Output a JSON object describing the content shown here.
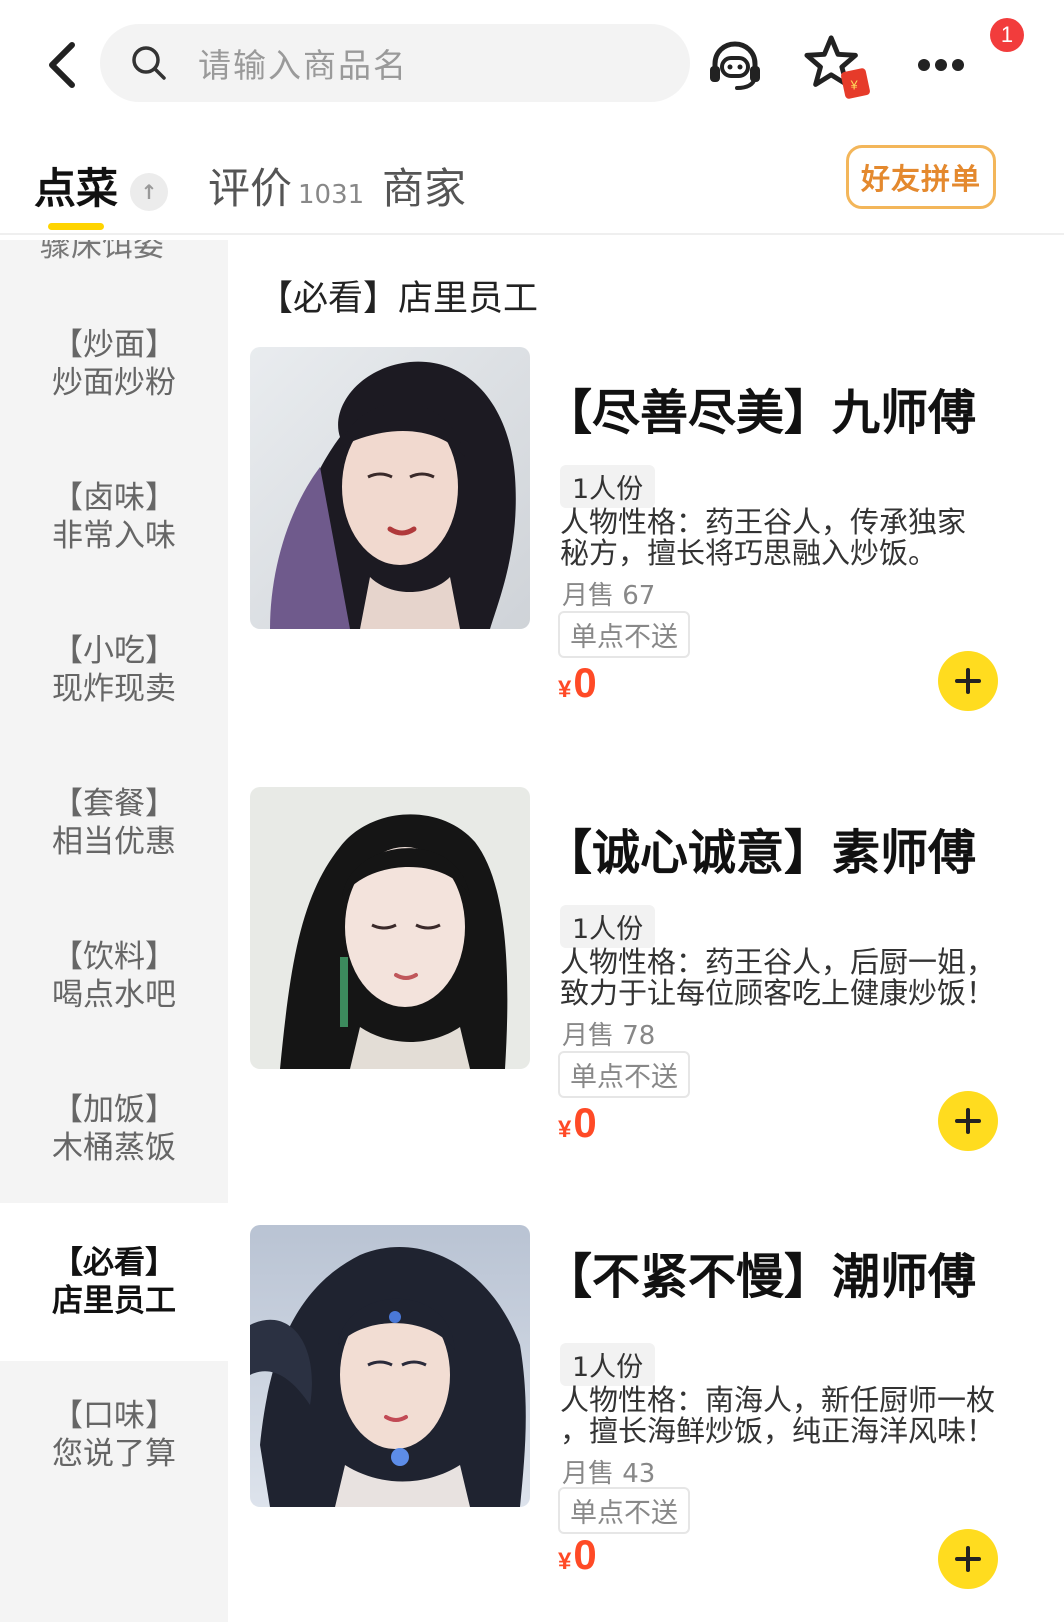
{
  "header": {
    "search_placeholder": "请输入商品名",
    "notification_count": "1",
    "icons": [
      "back-arrow-icon",
      "search-icon",
      "customer-service-icon",
      "favorite-star-icon",
      "more-icon"
    ]
  },
  "tabs": [
    {
      "label": "点菜",
      "active": true
    },
    {
      "label": "评价",
      "count": "1031"
    },
    {
      "label": "商家"
    }
  ],
  "tab_pin_glyph": "↑",
  "friend_order_label": "好友拼单",
  "sidebar": {
    "clipped_label": "骤床饵姿",
    "items": [
      {
        "line1": "【炒面】",
        "line2": "炒面炒粉"
      },
      {
        "line1": "【卤味】",
        "line2": "非常入味"
      },
      {
        "line1": "【小吃】",
        "line2": "现炸现卖"
      },
      {
        "line1": "【套餐】",
        "line2": "相当优惠"
      },
      {
        "line1": "【饮料】",
        "line2": "喝点水吧"
      },
      {
        "line1": "【加饭】",
        "line2": "木桶蒸饭"
      },
      {
        "line1": "【必看】",
        "line2": "店里员工",
        "active": true
      },
      {
        "line1": "【口味】",
        "line2": "您说了算"
      }
    ]
  },
  "section_title": "【必看】店里员工",
  "products": [
    {
      "name": "【尽善尽美】九师傅",
      "portion": "1人份",
      "desc_line1": "人物性格：药王谷人，传承独家",
      "desc_line2": "秘方，擅长将巧思融入炒饭。",
      "sold": "月售 67",
      "note": "单点不送",
      "currency": "¥",
      "price": "0"
    },
    {
      "name": "【诚心诚意】素师傅",
      "portion": "1人份",
      "desc_line1": "人物性格：药王谷人，后厨一姐，",
      "desc_line2": "致力于让每位顾客吃上健康炒饭！",
      "sold": "月售 78",
      "note": "单点不送",
      "currency": "¥",
      "price": "0"
    },
    {
      "name": "【不紧不慢】潮师傅",
      "portion": "1人份",
      "desc_line1": "人物性格：南海人，新任厨师一枚",
      "desc_line2": "，擅长海鲜炒饭，纯正海洋风味！",
      "sold": "月售 43",
      "note": "单点不送",
      "currency": "¥",
      "price": "0"
    }
  ],
  "colors": {
    "accent_yellow": "#ffdc1f",
    "price_red": "#ff4a26",
    "friend_btn_orange": "#e4892e",
    "badge_red": "#f23c3c"
  }
}
